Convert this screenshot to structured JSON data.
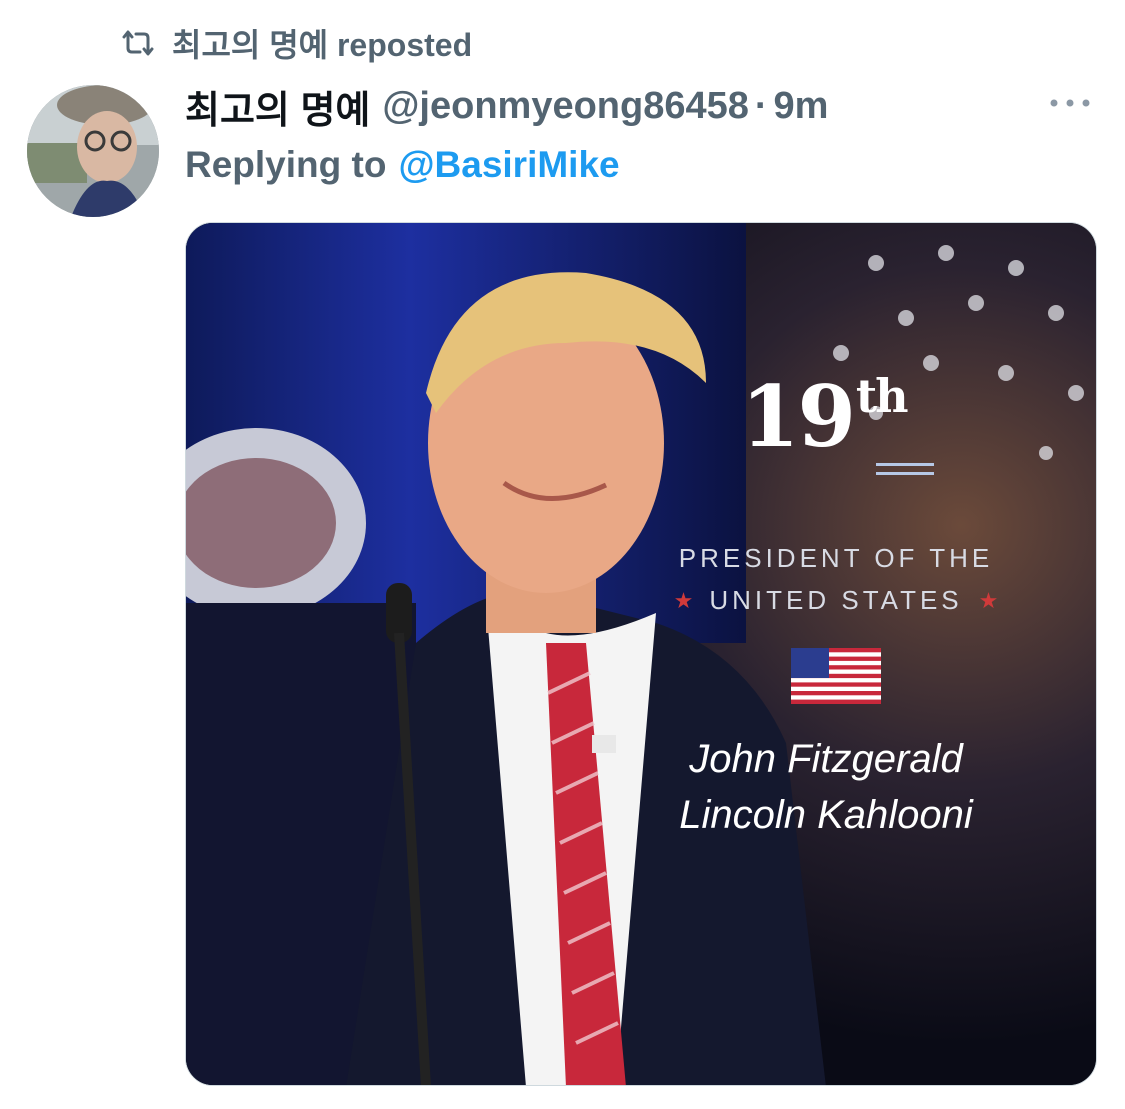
{
  "repost": {
    "icon": "repost-icon",
    "text": "최고의 명예 reposted"
  },
  "tweet": {
    "avatar_icon": "user-avatar",
    "display_name": "최고의 명예",
    "handle": "@jeonmyeong86458",
    "separator": "·",
    "time": "9m",
    "more_icon": "more-options-icon",
    "reply_prefix": "Replying to",
    "reply_handle": "@BasiriMike"
  },
  "media": {
    "ordinal_number": "19",
    "ordinal_suffix": "th",
    "line1": "PRESIDENT OF THE",
    "line2": "UNITED STATES",
    "line2_star": "★",
    "name_line1": "John Fitzgerald",
    "name_line2": "Lincoln Kahlooni"
  },
  "colors": {
    "primary_text": "#0f1419",
    "secondary_text": "#536471",
    "link": "#1d9bf0"
  }
}
